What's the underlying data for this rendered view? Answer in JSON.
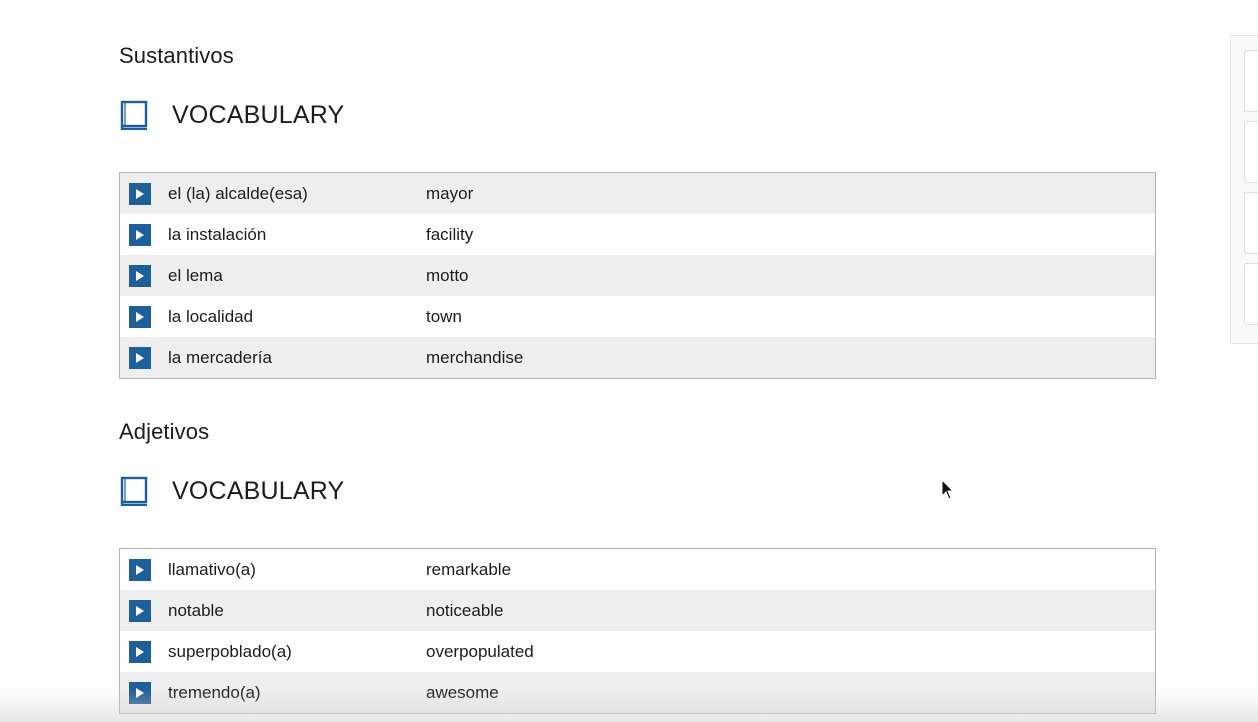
{
  "sections": [
    {
      "title": "Sustantivos",
      "vocab_label": "VOCABULARY",
      "rows": [
        {
          "term": "el (la) alcalde(esa)",
          "meaning": "mayor"
        },
        {
          "term": "la instalación",
          "meaning": "facility"
        },
        {
          "term": "el lema",
          "meaning": "motto"
        },
        {
          "term": "la localidad",
          "meaning": "town"
        },
        {
          "term": "la mercadería",
          "meaning": "merchandise"
        }
      ]
    },
    {
      "title": "Adjetivos",
      "vocab_label": "VOCABULARY",
      "rows": [
        {
          "term": "llamativo(a)",
          "meaning": "remarkable"
        },
        {
          "term": "notable",
          "meaning": "noticeable"
        },
        {
          "term": "superpoblado(a)",
          "meaning": "overpopulated"
        },
        {
          "term": "tremendo(a)",
          "meaning": "awesome"
        }
      ]
    }
  ],
  "icons": {
    "book": "book-icon",
    "play": "play-icon",
    "cursor": "mouse-pointer-icon"
  },
  "colors": {
    "accent": "#1f5f99",
    "row_alt": "#eeeeee",
    "border": "#b5b5b5"
  }
}
